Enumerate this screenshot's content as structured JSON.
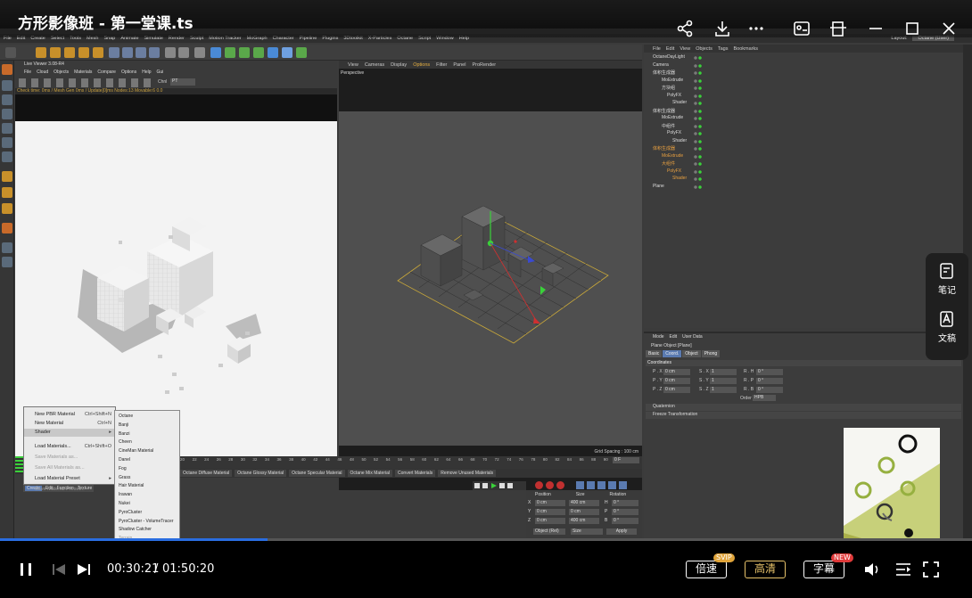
{
  "video": {
    "title": "方形影像班 - 第一堂课.ts",
    "current_time": "00:30:21",
    "separator": "/",
    "total_time": "01:50:20",
    "progress": 0.275,
    "accent": "#2a6de0"
  },
  "top_icons": [
    "share-icon",
    "download-icon",
    "more-icon",
    "screenshot-icon",
    "pin-icon",
    "minimize-icon",
    "maximize-icon",
    "close-icon"
  ],
  "controls": {
    "speed": {
      "label": "倍速",
      "badge": "SVIP",
      "badge_color": "#e0a43a"
    },
    "quality": {
      "label": "高清",
      "color": "#e8c36a"
    },
    "subtitle": {
      "label": "字幕",
      "badge": "NEW",
      "badge_color": "#e03a3a"
    }
  },
  "side_panel": {
    "notes": "笔记",
    "transcript": "文稿"
  },
  "c4d": {
    "menubar": [
      "File",
      "Edit",
      "Create",
      "Select",
      "Tools",
      "Mesh",
      "Snap",
      "Animate",
      "Simulate",
      "Render",
      "Sculpt",
      "Motion Tracker",
      "MoGraph",
      "Character",
      "Pipeline",
      "Plugins",
      "3Dtoolkit",
      "X-Particles",
      "Octane",
      "Script",
      "Window",
      "Help"
    ],
    "layout_label": "Layout:",
    "layout_value": "Octane (User)",
    "live_viewer": {
      "title": "Live Viewer 3.08-R4",
      "menu": [
        "File",
        "Cloud",
        "Objects",
        "Materials",
        "Compare",
        "Options",
        "Help",
        "Gui"
      ],
      "channel_label": "Chnl",
      "channel_value": "PT",
      "status": "Check time: 0ms / Mesh Gen 0ms / Update[0]ms  Nodes:13 Movable:6  0.0"
    },
    "viewport": {
      "menu": [
        "View",
        "Cameras",
        "Display",
        "Options",
        "Filter",
        "Panel",
        "ProRender"
      ],
      "label": "Perspective",
      "grid_spacing": "Grid Spacing : 100 cm"
    },
    "object_manager": {
      "menu": [
        "File",
        "Edit",
        "View",
        "Objects",
        "Tags",
        "Bookmarks"
      ],
      "items": [
        "OctaneDayLight",
        "Camera",
        "体积生成器",
        "MoExtrude",
        "方块组",
        "PolyFX",
        "Shader",
        "体积生成器",
        "MoExtrude",
        "中组件",
        "PolyFX",
        "Shader",
        "体积生成器",
        "MoExtrude",
        "大组件",
        "PolyFX",
        "Shader",
        "Plane"
      ]
    },
    "attributes": {
      "menu": [
        "Mode",
        "Edit",
        "User Data"
      ],
      "object_title": "Plane Object [Plane]",
      "tabs": [
        "Basic",
        "Coord.",
        "Object",
        "Phong"
      ],
      "section": "Coordinates",
      "rows": [
        {
          "p": "P . X",
          "pv": "0 cm",
          "s": "S . X",
          "sv": "1",
          "r": "R . H",
          "rv": "0 °"
        },
        {
          "p": "P . Y",
          "pv": "0 cm",
          "s": "S . Y",
          "sv": "1",
          "r": "R . P",
          "rv": "0 °"
        },
        {
          "p": "P . Z",
          "pv": "0 cm",
          "s": "S . Z",
          "sv": "1",
          "r": "R . B",
          "rv": "0 °"
        }
      ],
      "order_label": "Order",
      "order_value": "HPB",
      "collapsed": [
        "Quaternion",
        "Freeze Transformation"
      ]
    },
    "timeline_ticks": [
      "20",
      "22",
      "24",
      "26",
      "28",
      "30",
      "32",
      "34",
      "36",
      "38",
      "40",
      "42",
      "44",
      "46",
      "48",
      "50",
      "52",
      "54",
      "56",
      "58",
      "60",
      "62",
      "64",
      "66",
      "68",
      "70",
      "72",
      "74",
      "76",
      "78",
      "80",
      "82",
      "84",
      "86",
      "88",
      "90"
    ],
    "frame_field": "0 F",
    "material_tabs": [
      "Octane Diffuse Material",
      "Octane Glossy Material",
      "Octane Specular Material",
      "Octane Mix Material",
      "Convert Materials",
      "Remove Unused Materials"
    ],
    "material_menu": [
      "Create",
      "Edit",
      "Function",
      "Texture"
    ],
    "coords": {
      "headers": [
        "Position",
        "Size",
        "Rotation"
      ],
      "rows": [
        [
          "X",
          "0 cm",
          "400 cm",
          "H",
          "0 °"
        ],
        [
          "Y",
          "0 cm",
          "0 cm",
          "P",
          "0 °"
        ],
        [
          "Z",
          "0 cm",
          "400 cm",
          "B",
          "0 °"
        ]
      ],
      "object_mode": "Object (Rel)",
      "size_mode": "Size",
      "apply": "Apply"
    },
    "context_menu": [
      {
        "label": "New PBR Material",
        "shortcut": "Ctrl+Shift+N"
      },
      {
        "label": "New Material",
        "shortcut": "Ctrl+N"
      },
      {
        "label": "Shader",
        "shortcut": "▸"
      },
      {
        "label": "Load Materials...",
        "shortcut": "Ctrl+Shift+O"
      },
      {
        "label": "Save Materials as...",
        "shortcut": ""
      },
      {
        "label": "Save All Materials as...",
        "shortcut": ""
      },
      {
        "label": "Load Material Preset",
        "shortcut": "▸"
      },
      {
        "label": "Save Material Preset...",
        "shortcut": ""
      }
    ],
    "submenu": [
      "Octane",
      "Banji",
      "Banzi",
      "Cheen",
      "CineMan Material",
      "Danel",
      "Fog",
      "Grass",
      "Hair Material",
      "Irawan",
      "Nukei",
      "PyroCluster",
      "PyroCluster - VolumeTracer",
      "Shadow Catcher",
      "Terrain",
      "Toon",
      "X-Particles Material"
    ]
  }
}
